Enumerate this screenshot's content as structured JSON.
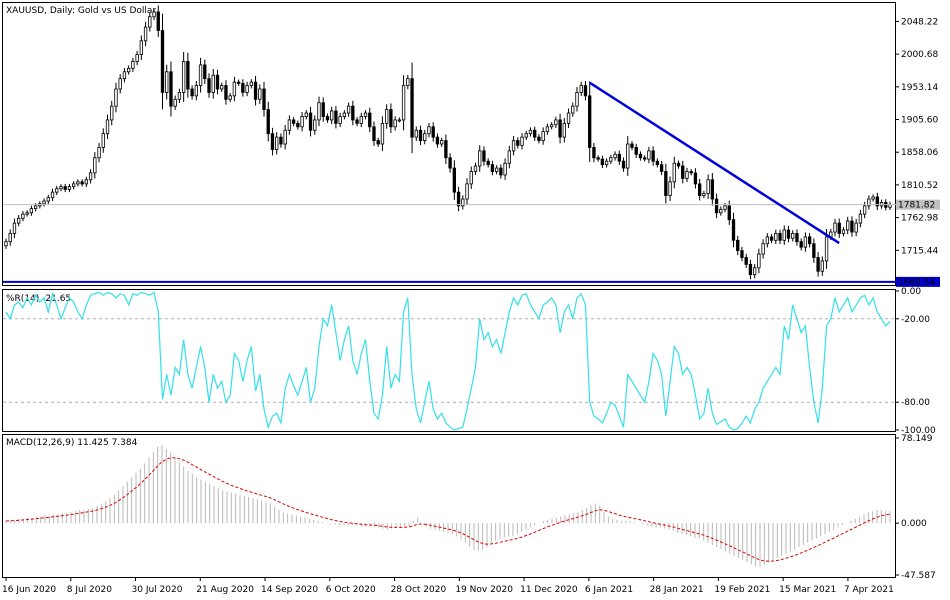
{
  "chart_data": [
    {
      "type": "candlestick",
      "title": "XAUUSD, Daily:  Gold vs US Dollar",
      "price_ticks": [
        2048.22,
        2000.68,
        1953.14,
        1905.6,
        1858.06,
        1810.52,
        1762.98,
        1715.44
      ],
      "price_tick_labels": [
        "2048.22",
        "2000.68",
        "1953.14",
        "1905.60",
        "1858.06",
        "1810.52",
        "1762.98",
        "1715.44"
      ],
      "ylim": [
        1665,
        2075
      ],
      "current_price": 1781.82,
      "current_price_label": "1781.82",
      "support_level": 1669.54,
      "support_label": "1669.54",
      "x_labels": [
        "16 Jun 2020",
        "8 Jul 2020",
        "30 Jul 2020",
        "21 Aug 2020",
        "14 Sep 2020",
        "6 Oct 2020",
        "28 Oct 2020",
        "19 Nov 2020",
        "11 Dec 2020",
        "6 Jan 2021",
        "28 Jan 2021",
        "19 Feb 2021",
        "15 Mar 2021",
        "7 Apr 2021"
      ],
      "trendline": {
        "from": {
          "date": "6 Jan 2021",
          "price": 1959
        },
        "to": {
          "date": "2 Apr 2021",
          "price": 1726
        }
      },
      "closes": [
        1728,
        1740,
        1755,
        1762,
        1768,
        1770,
        1776,
        1780,
        1783,
        1787,
        1792,
        1800,
        1805,
        1808,
        1804,
        1808,
        1812,
        1815,
        1812,
        1818,
        1828,
        1850,
        1865,
        1885,
        1905,
        1925,
        1950,
        1965,
        1975,
        1980,
        1990,
        2000,
        2020,
        2040,
        2055,
        2062,
        2035,
        1945,
        1975,
        1925,
        1935,
        1945,
        1990,
        1950,
        1940,
        1955,
        1985,
        1965,
        1945,
        1970,
        1950,
        1955,
        1935,
        1940,
        1960,
        1958,
        1945,
        1955,
        1960,
        1935,
        1950,
        1920,
        1885,
        1862,
        1880,
        1870,
        1890,
        1905,
        1900,
        1895,
        1910,
        1915,
        1890,
        1905,
        1930,
        1910,
        1905,
        1918,
        1900,
        1910,
        1915,
        1925,
        1905,
        1900,
        1910,
        1915,
        1895,
        1875,
        1870,
        1900,
        1920,
        1895,
        1905,
        1905,
        1955,
        1965,
        1880,
        1890,
        1875,
        1885,
        1895,
        1880,
        1870,
        1875,
        1850,
        1835,
        1800,
        1780,
        1790,
        1812,
        1830,
        1838,
        1860,
        1845,
        1840,
        1830,
        1835,
        1825,
        1842,
        1860,
        1875,
        1868,
        1880,
        1885,
        1890,
        1880,
        1875,
        1888,
        1895,
        1898,
        1905,
        1880,
        1900,
        1915,
        1925,
        1945,
        1955,
        1940,
        1865,
        1850,
        1848,
        1840,
        1845,
        1850,
        1855,
        1845,
        1835,
        1870,
        1865,
        1855,
        1850,
        1848,
        1860,
        1845,
        1840,
        1830,
        1795,
        1815,
        1842,
        1838,
        1820,
        1830,
        1828,
        1812,
        1795,
        1798,
        1818,
        1790,
        1770,
        1775,
        1780,
        1760,
        1730,
        1715,
        1705,
        1695,
        1680,
        1690,
        1710,
        1725,
        1735,
        1730,
        1740,
        1730,
        1745,
        1733,
        1740,
        1728,
        1720,
        1735,
        1725,
        1705,
        1685,
        1700,
        1735,
        1742,
        1755,
        1740,
        1745,
        1758,
        1742,
        1755,
        1768,
        1780,
        1790,
        1793,
        1780,
        1785,
        1778,
        1782
      ]
    },
    {
      "type": "line",
      "title": "%R(14) -21.65",
      "ylim": [
        -100,
        0
      ],
      "ticks": [
        0,
        -20,
        -80,
        -100
      ],
      "tick_labels": [
        "0.00",
        "-20.00",
        "-80.00",
        "-100.00"
      ],
      "levels": [
        -20,
        -80
      ],
      "values": [
        -15,
        -20,
        -10,
        -8,
        -12,
        -5,
        -10,
        -3,
        -8,
        -5,
        -15,
        -2,
        -10,
        -20,
        -12,
        -5,
        -8,
        -15,
        -20,
        -10,
        -3,
        -2,
        -1,
        -3,
        -1,
        -2,
        -5,
        -2,
        -3,
        -10,
        -2,
        -3,
        -1,
        -2,
        -3,
        -1,
        -15,
        -78,
        -60,
        -75,
        -55,
        -60,
        -35,
        -60,
        -70,
        -55,
        -40,
        -55,
        -80,
        -60,
        -70,
        -65,
        -80,
        -75,
        -45,
        -50,
        -65,
        -50,
        -40,
        -72,
        -60,
        -85,
        -98,
        -90,
        -88,
        -95,
        -70,
        -60,
        -68,
        -75,
        -65,
        -55,
        -80,
        -70,
        -40,
        -20,
        -25,
        -10,
        -30,
        -50,
        -35,
        -25,
        -50,
        -60,
        -45,
        -35,
        -65,
        -88,
        -92,
        -75,
        -40,
        -70,
        -60,
        -65,
        -15,
        -5,
        -60,
        -85,
        -95,
        -80,
        -65,
        -85,
        -92,
        -88,
        -95,
        -98,
        -100,
        -99,
        -98,
        -85,
        -70,
        -55,
        -20,
        -35,
        -30,
        -40,
        -35,
        -45,
        -30,
        -15,
        -5,
        -10,
        -3,
        -2,
        -10,
        -15,
        -20,
        -10,
        -8,
        -5,
        -10,
        -30,
        -15,
        -10,
        -20,
        -5,
        -2,
        -10,
        -80,
        -90,
        -92,
        -95,
        -88,
        -80,
        -82,
        -90,
        -98,
        -60,
        -65,
        -70,
        -75,
        -80,
        -65,
        -45,
        -50,
        -60,
        -90,
        -65,
        -40,
        -45,
        -60,
        -55,
        -60,
        -75,
        -92,
        -88,
        -70,
        -88,
        -96,
        -94,
        -92,
        -98,
        -100,
        -99,
        -95,
        -90,
        -95,
        -85,
        -80,
        -70,
        -65,
        -60,
        -55,
        -60,
        -25,
        -35,
        -10,
        -20,
        -30,
        -25,
        -55,
        -80,
        -95,
        -70,
        -25,
        -20,
        -5,
        -15,
        -10,
        -5,
        -15,
        -10,
        -5,
        -3,
        -10,
        -5,
        -15,
        -20,
        -25,
        -22
      ]
    },
    {
      "type": "bar+line",
      "title": "MACD(12,26,9) 11.425 7.384",
      "ylim": [
        -47.587,
        78.149
      ],
      "ticks": [
        78.149,
        0,
        -47.587
      ],
      "tick_labels": [
        "78.149",
        "0.000",
        "-47.587"
      ],
      "macd": [
        2,
        3,
        3,
        4,
        4,
        5,
        5,
        6,
        6,
        7,
        7,
        8,
        8,
        9,
        9,
        10,
        11,
        12,
        12,
        13,
        14,
        16,
        18,
        20,
        23,
        26,
        30,
        34,
        38,
        42,
        46,
        50,
        55,
        60,
        65,
        70,
        72,
        68,
        65,
        60,
        56,
        52,
        48,
        45,
        42,
        40,
        38,
        36,
        34,
        32,
        30,
        29,
        28,
        27,
        26,
        25,
        24,
        23,
        22,
        21,
        20,
        18,
        15,
        12,
        10,
        9,
        8,
        7,
        6,
        5,
        4,
        3,
        2,
        1,
        0,
        -1,
        -1,
        -2,
        -2,
        -2,
        -2,
        -2,
        -3,
        -3,
        -3,
        -3,
        -4,
        -5,
        -6,
        -5,
        -4,
        -4,
        -3,
        -3,
        2,
        5,
        0,
        -3,
        -5,
        -6,
        -7,
        -8,
        -9,
        -10,
        -12,
        -15,
        -18,
        -22,
        -25,
        -25,
        -24,
        -22,
        -18,
        -16,
        -14,
        -13,
        -12,
        -12,
        -10,
        -8,
        -6,
        -4,
        -2,
        0,
        2,
        3,
        4,
        5,
        6,
        7,
        8,
        9,
        10,
        12,
        14,
        16,
        18,
        16,
        10,
        6,
        4,
        3,
        2,
        2,
        2,
        1,
        0,
        -1,
        -2,
        -3,
        -4,
        -4,
        -5,
        -6,
        -7,
        -9,
        -10,
        -11,
        -12,
        -13,
        -14,
        -16,
        -18,
        -20,
        -22,
        -24,
        -26,
        -28,
        -30,
        -32,
        -34,
        -36,
        -38,
        -40,
        -40,
        -38,
        -36,
        -34,
        -32,
        -30,
        -28,
        -26,
        -24,
        -22,
        -20,
        -18,
        -16,
        -14,
        -12,
        -10,
        -8,
        -6,
        -4,
        -2,
        0,
        2,
        4,
        6,
        8,
        10,
        11,
        12,
        12,
        11,
        11
      ]
    }
  ]
}
